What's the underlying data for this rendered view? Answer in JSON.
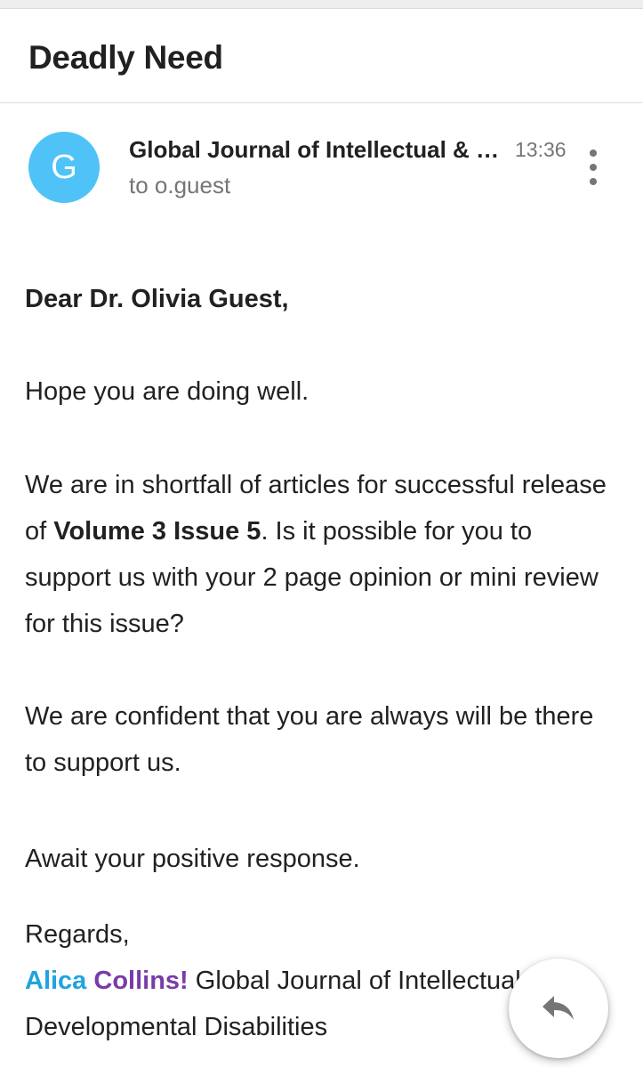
{
  "email": {
    "subject": "Deadly Need",
    "sender": {
      "initial": "G",
      "name": "Global Journal of Intellectual & Developmental Disabilities",
      "avatar_color": "#4fc3f7"
    },
    "time": "13:36",
    "recipient": "to o.guest",
    "more_icon": "more-vertical-icon",
    "body": {
      "greeting": "Dear Dr. Olivia Guest,",
      "paragraph1": "Hope you are doing well.",
      "paragraph2": {
        "before": "We are in shortfall of articles for successful release of ",
        "bold": "Volume 3 Issue 5",
        "after": ". Is it possible for you to support us with your 2 page opinion or mini review for this issue?"
      },
      "paragraph3": "We are confident that you are always will be there to support us.",
      "paragraph4": "Await your positive response.",
      "signoff": "Regards,",
      "signature": {
        "first_name": "Alica",
        "last_name": "Collins!",
        "org": " Global Journal of Intellectual & Developmental Disabilities",
        "first_name_color": "#1fa4e0",
        "last_name_color": "#7a3ba8"
      }
    }
  },
  "reply_button": {
    "icon": "reply-icon"
  }
}
